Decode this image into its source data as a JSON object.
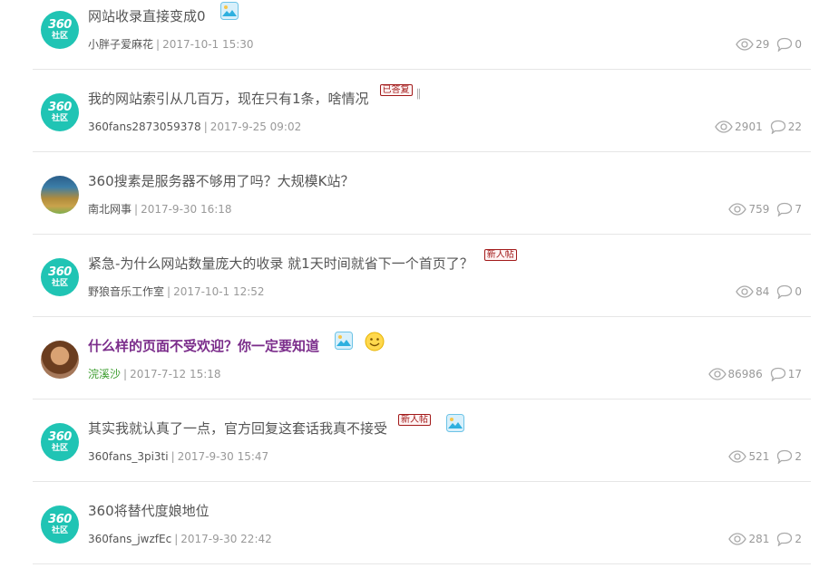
{
  "brand_avatar": {
    "number": "360",
    "text": "社区",
    "color": "#20c4b4"
  },
  "accent_colors": {
    "hot_title": "#7b2d8b",
    "badge": "#a21a1a",
    "green_author": "#3b9c2d"
  },
  "threads": [
    {
      "title": "网站收录直接变成0",
      "author": "小胖子爱麻花",
      "date": "2017-10-1 15:30",
      "views": "29",
      "replies": "0",
      "icons": [
        "image-icon"
      ]
    },
    {
      "title": "我的网站索引从几百万，现在只有1条，啥情况",
      "badge": "已答复",
      "author": "360fans2873059378",
      "date": "2017-9-25 09:02",
      "views": "2901",
      "replies": "22",
      "icons": [
        "paperclip-icon"
      ]
    },
    {
      "title": "360搜素是服务器不够用了吗？大规模K站？",
      "author": "南北网事",
      "date": "2017-9-30 16:18",
      "views": "759",
      "replies": "7",
      "icons": []
    },
    {
      "title": "紧急-为什么网站数量庞大的收录 就1天时间就省下一个首页了？",
      "badge": "新人帖",
      "author": "野狼音乐工作室",
      "date": "2017-10-1 12:52",
      "views": "84",
      "replies": "0",
      "icons": []
    },
    {
      "title": "什么样的页面不受欢迎？你一定要知道",
      "author": "浣溪沙",
      "date": "2017-7-12 15:18",
      "views": "86986",
      "replies": "17",
      "icons": [
        "image-icon",
        "smile-icon"
      ]
    },
    {
      "title": "其实我就认真了一点，官方回复这套话我真不接受",
      "badge": "新人帖",
      "author": "360fans_3pi3ti",
      "date": "2017-9-30 15:47",
      "views": "521",
      "replies": "2",
      "icons": [
        "image-icon"
      ]
    },
    {
      "title": "360将替代度娘地位",
      "author": "360fans_jwzfEc",
      "date": "2017-9-30 22:42",
      "views": "281",
      "replies": "2",
      "icons": []
    }
  ]
}
